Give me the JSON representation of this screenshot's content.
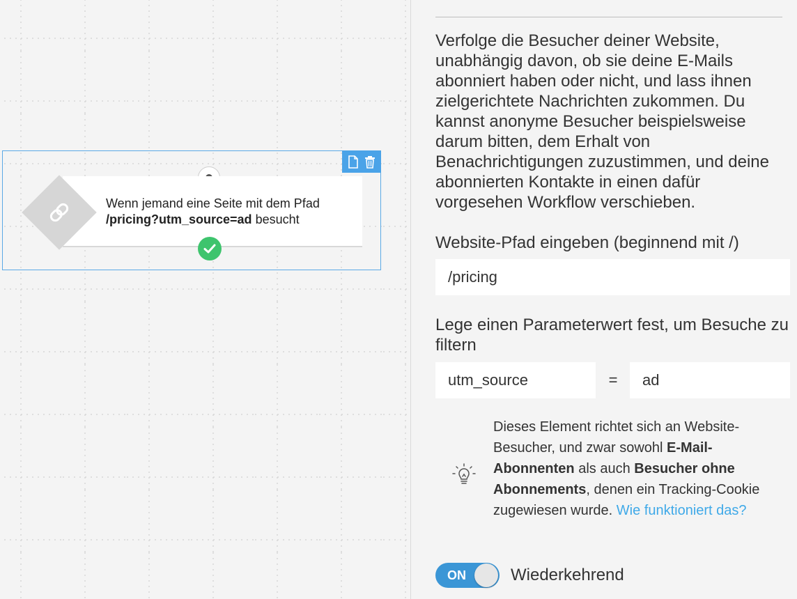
{
  "canvas": {
    "node": {
      "text_prefix": "Wenn jemand eine Seite mit dem Pfad",
      "text_bold": "/pricing?utm_source=ad",
      "text_suffix": " besucht",
      "icon": "link-icon",
      "toolbar": {
        "copy_icon": "document-icon",
        "delete_icon": "trash-icon"
      },
      "status_icon": "check-icon"
    },
    "colors": {
      "selection_border": "#5aa9e6",
      "toolbar_bg": "#4aa3e8",
      "success": "#3ec46d"
    }
  },
  "panel": {
    "description": "Verfolge die Besucher deiner Website, unabhängig davon, ob sie deine E-Mails abonniert haben oder nicht, und lass ihnen zielgerichtete Nachrichten zukommen. Du kannst anonyme Besucher beispielsweise darum bitten, dem Erhalt von Benachrichtigungen zuzustimmen, und deine abonnierten Kontakte in einen dafür vorgesehen Workflow verschieben.",
    "path_label": "Website-Pfad eingeben (beginnend mit /)",
    "path_value": "/pricing",
    "param_label": "Lege einen Parameterwert fest, um Besuche zu filtern",
    "param_key": "utm_source",
    "param_equals": "=",
    "param_value": "ad",
    "hint": {
      "icon": "lightbulb-icon",
      "part1": "Dieses Element richtet sich an Website-Besucher, und zwar sowohl ",
      "bold1": "E-Mail-Abonnenten",
      "part2": " als auch ",
      "bold2": "Besucher ohne Abonnements",
      "part3": ", denen ein Tracking-Cookie zugewiesen wurde. ",
      "link": "Wie funktioniert das?"
    },
    "toggle": {
      "state": "ON",
      "label": "Wiederkehrend"
    },
    "colors": {
      "link": "#3fa9e8",
      "toggle_on": "#3b96d6"
    }
  }
}
